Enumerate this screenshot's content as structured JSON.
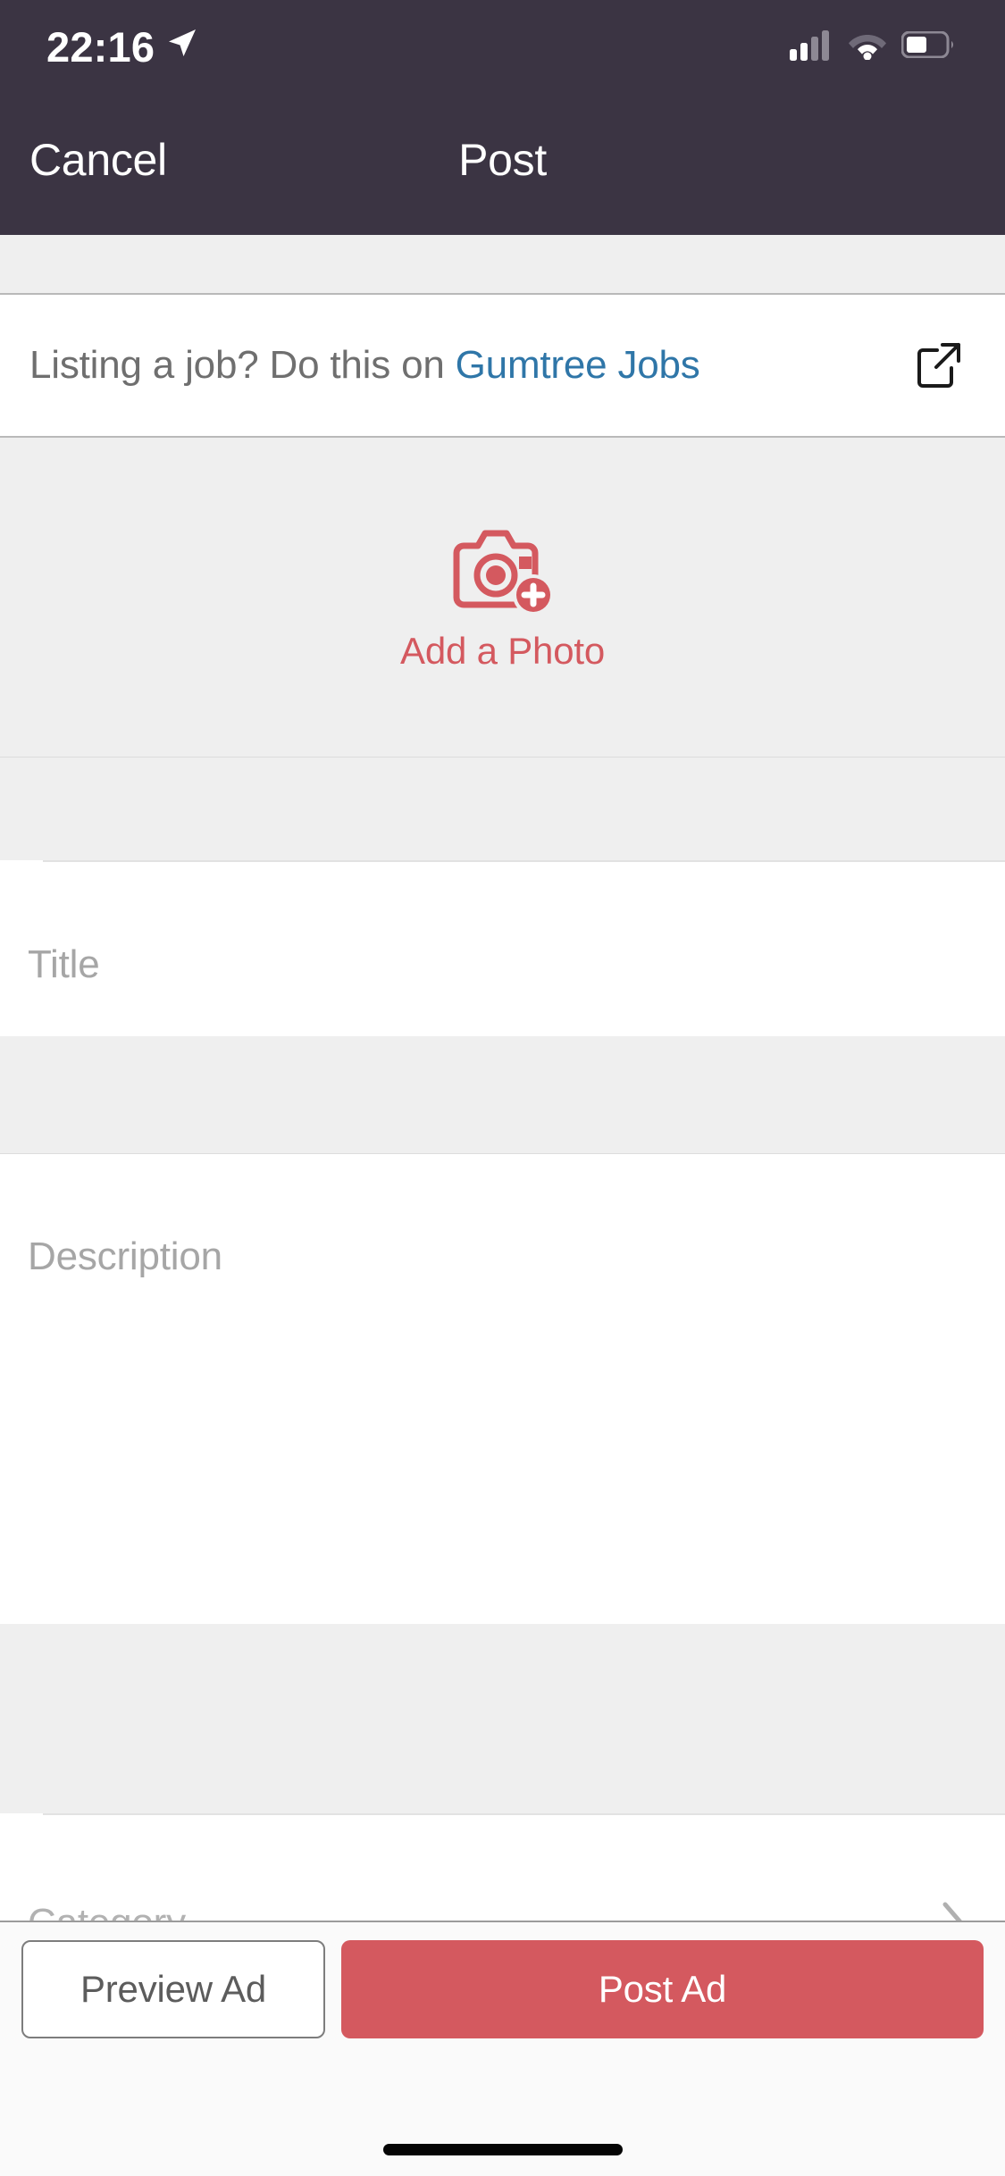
{
  "status_bar": {
    "time": "22:16",
    "icons": [
      "location-arrow-icon",
      "cellular-signal-icon",
      "wifi-icon",
      "battery-icon"
    ],
    "background_color": "#3b3443",
    "foreground_color": "#ffffff"
  },
  "nav_bar": {
    "cancel_label": "Cancel",
    "title": "Post"
  },
  "jobs_banner": {
    "text_prefix": "Listing a job? Do this on ",
    "link_label": "Gumtree Jobs",
    "link_color": "#2f76a8",
    "icon": "external-link-icon"
  },
  "photo_section": {
    "icon": "camera-add-icon",
    "label": "Add a Photo",
    "accent_color": "#d4595f"
  },
  "fields": {
    "title": {
      "label": "Title",
      "value": "",
      "placeholder": "Title"
    },
    "description": {
      "label": "Description",
      "value": "",
      "placeholder": "Description"
    },
    "category": {
      "label": "Category",
      "value": "",
      "placeholder": "Category",
      "chevron": "chevron-right-icon"
    }
  },
  "bottom_bar": {
    "preview_label": "Preview Ad",
    "post_label": "Post Ad",
    "post_color": "#d4595f"
  }
}
